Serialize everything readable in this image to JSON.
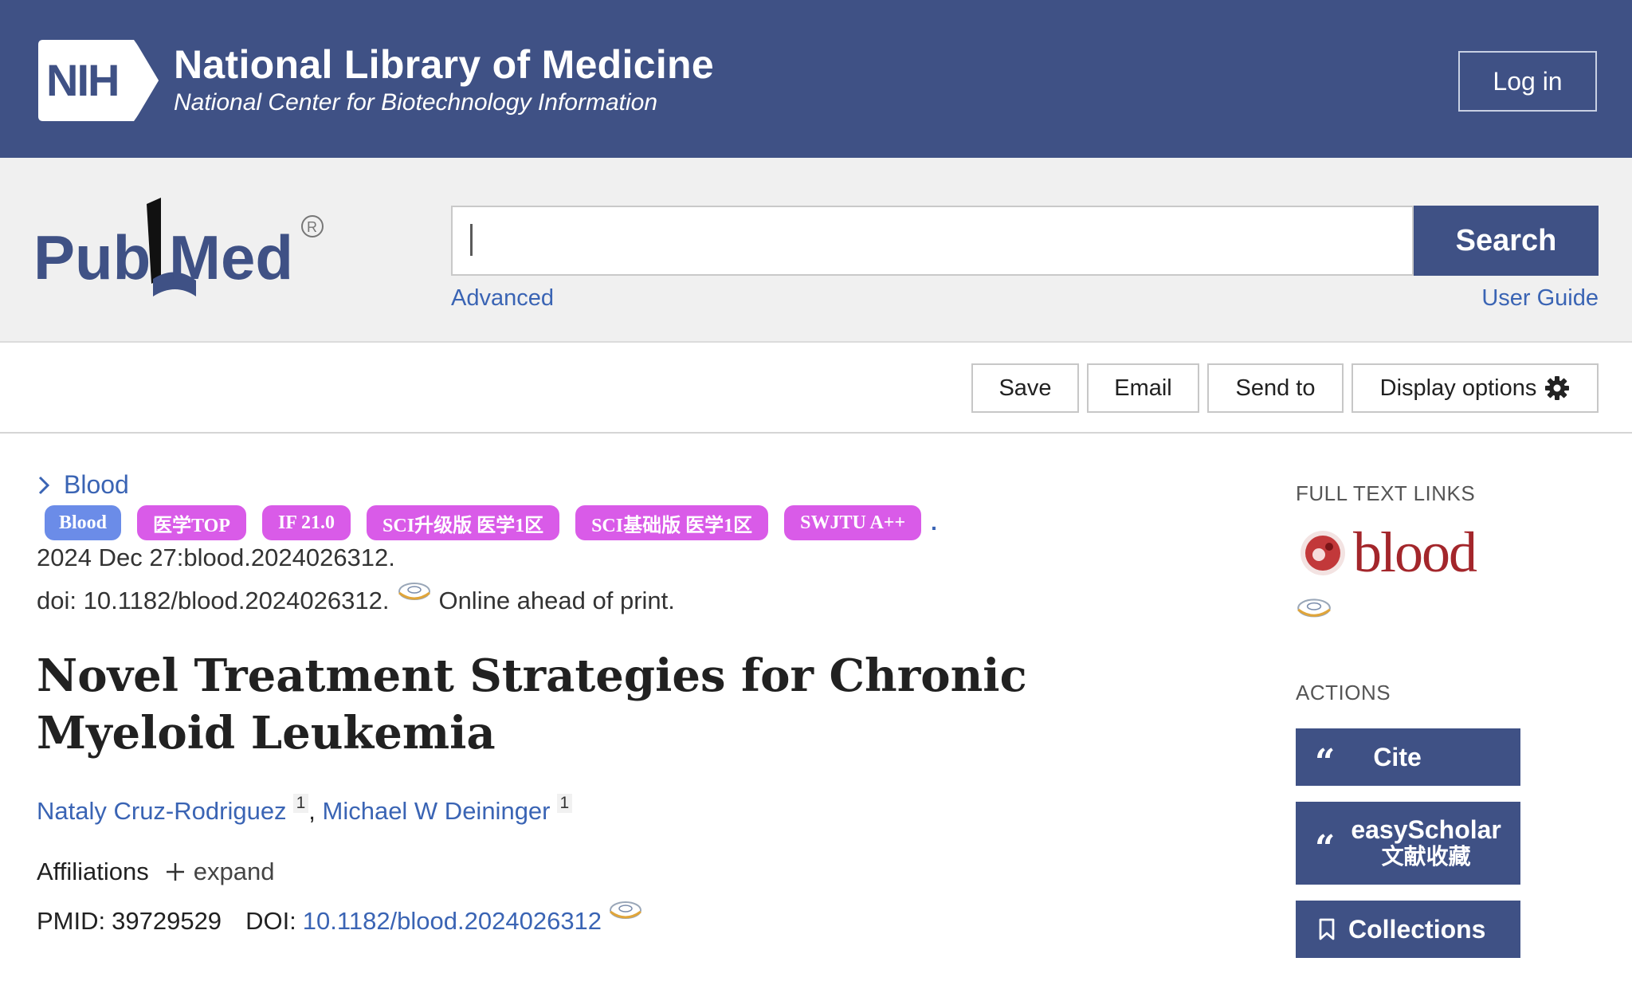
{
  "nih": {
    "logo_text": "NIH",
    "title": "National Library of Medicine",
    "subtitle": "National Center for Biotechnology Information",
    "login_label": "Log in"
  },
  "search": {
    "logo_text": "PubMed",
    "value": "",
    "button_label": "Search",
    "advanced_label": "Advanced",
    "user_guide_label": "User Guide"
  },
  "toolbar": {
    "save_label": "Save",
    "email_label": "Email",
    "send_to_label": "Send to",
    "display_options_label": "Display options"
  },
  "article": {
    "journal": "Blood",
    "badges": [
      {
        "label": "Blood",
        "color": "#6b8ce8"
      },
      {
        "label": "医学TOP",
        "color": "#d95be8"
      },
      {
        "label": "IF 21.0",
        "color": "#d95be8"
      },
      {
        "label": "SCI升级版 医学1区",
        "color": "#d95be8"
      },
      {
        "label": "SCI基础版 医学1区",
        "color": "#d95be8"
      },
      {
        "label": "SWJTU A++",
        "color": "#d95be8"
      }
    ],
    "badge_trailing": ".",
    "citation": "2024 Dec 27:blood.2024026312.",
    "doi_text": "doi: 10.1182/blood.2024026312.",
    "status": "Online ahead of print.",
    "title": "Novel Treatment Strategies for Chronic Myeloid Leukemia",
    "authors": [
      {
        "name": "Nataly Cruz-Rodriguez",
        "affiliation": "1"
      },
      {
        "name": "Michael W Deininger",
        "affiliation": "1"
      }
    ],
    "author_separator": ",",
    "affiliations_label": "Affiliations",
    "expand_label": "expand",
    "pmid_label": "PMID:",
    "pmid": "39729529",
    "doi_label": "DOI:",
    "doi": "10.1182/blood.2024026312"
  },
  "sidebar": {
    "full_text_heading": "FULL TEXT LINKS",
    "publisher_logo_text": "blood",
    "actions_heading": "ACTIONS",
    "cite_label": "Cite",
    "easyscholar_label": "easyScholar",
    "easyscholar_sub": "文献收藏",
    "collections_label": "Collections"
  },
  "colors": {
    "header_bg": "#3f5185",
    "link": "#3a64b4",
    "badge_blue": "#6b8ce8",
    "badge_pink": "#d95be8",
    "blood_red": "#a3262b"
  }
}
